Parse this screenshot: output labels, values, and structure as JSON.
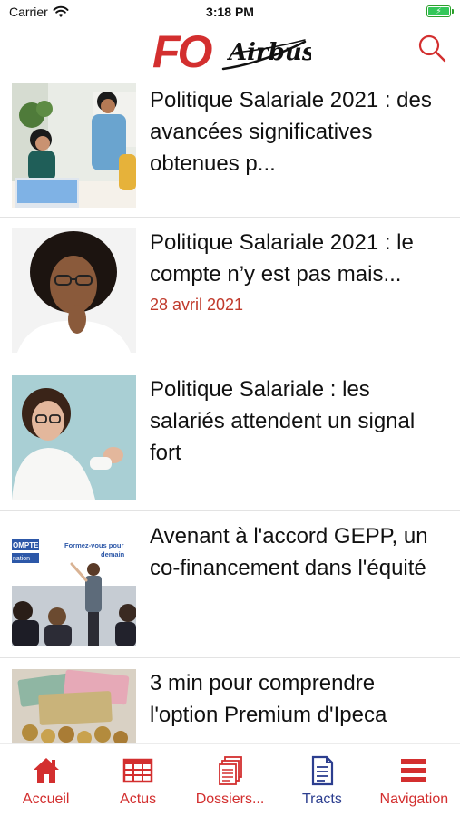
{
  "status_bar": {
    "carrier": "Carrier",
    "time": "3:18 PM"
  },
  "header": {
    "logo_fo": "FO",
    "logo_airbus": "Airbus"
  },
  "colors": {
    "brand_red": "#d32f2f",
    "active_blue": "#2c3e8f",
    "date_red": "#c0392b"
  },
  "articles": [
    {
      "title": "Politique Salariale 2021 : des avancées significatives obtenues p...",
      "date": ""
    },
    {
      "title": "Politique Salariale 2021 : le compte n’y est pas mais...",
      "date": "28 avril 2021"
    },
    {
      "title": "Politique Salariale :  les salariés attendent un signal fort",
      "date": ""
    },
    {
      "title": "Avenant à l'accord GEPP, un co-financement dans l'équité",
      "date": ""
    },
    {
      "title": "3 min pour comprendre l'option Premium d'Ipeca",
      "date": ""
    }
  ],
  "thumb_text": {
    "slide_heading": "Formez-vous pour demain",
    "slide_left_top": "OMPTE",
    "slide_left_bottom": "nation"
  },
  "tabs": [
    {
      "label": "Accueil",
      "icon": "home-icon"
    },
    {
      "label": "Actus",
      "icon": "news-grid-icon"
    },
    {
      "label": "Dossiers...",
      "icon": "documents-icon"
    },
    {
      "label": "Tracts",
      "icon": "document-icon",
      "active": true
    },
    {
      "label": "Navigation",
      "icon": "menu-icon"
    }
  ]
}
